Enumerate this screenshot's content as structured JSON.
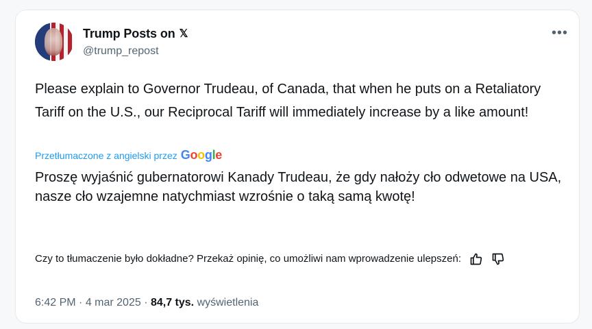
{
  "author": {
    "name": "Trump Posts on",
    "platform_glyph": "𝕏",
    "handle": "@trump_repost"
  },
  "menu_icon": "more-icon",
  "original_text": "Please explain to Governor Trudeau, of Canada, that when he puts on a Retaliatory Tariff on the U.S., our Reciprocal Tariff will immediately increase by a like amount!",
  "translation": {
    "label": "Przetłumaczone z angielski przez",
    "provider": {
      "G": "G",
      "o1": "o",
      "o2": "o",
      "g": "g",
      "l": "l",
      "e": "e"
    },
    "text": "Proszę wyjaśnić gubernatorowi Kanady Trudeau, że gdy nałoży cło odwetowe na USA, nasze cło wzajemne natychmiast wzrośnie o taką samą kwotę!",
    "feedback_prompt": "Czy to tłumaczenie było dokładne? Przekaż opinię, co umożliwi nam wprowadzenie ulepszeń:",
    "feedback_icons": [
      "thumbs-up-icon",
      "thumbs-down-icon"
    ]
  },
  "meta": {
    "time": "6:42 PM",
    "sep1": " · ",
    "date": "4 mar 2025",
    "sep2": " · ",
    "views_count": "84,7 tys.",
    "views_label": " wyświetlenia"
  },
  "colors": {
    "link_blue": "#1d9bf0",
    "secondary_text": "#536471",
    "primary_text": "#0f1419"
  }
}
